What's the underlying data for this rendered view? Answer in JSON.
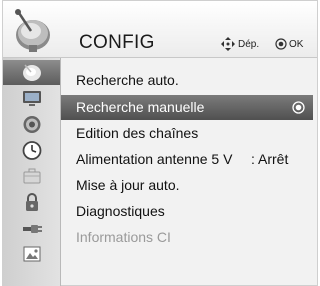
{
  "header": {
    "title": "CONFIG",
    "hints": {
      "nav_icon": "four-way-arrows-icon",
      "nav_label": "Dép.",
      "ok_icon": "ok-circle-icon",
      "ok_label": "OK"
    },
    "logo_icon": "satellite-dish-icon"
  },
  "sidebar": {
    "items": [
      {
        "icon": "satellite-dish-icon",
        "active": true
      },
      {
        "icon": "monitor-icon",
        "active": false
      },
      {
        "icon": "speaker-icon",
        "active": false
      },
      {
        "icon": "clock-icon",
        "active": false
      },
      {
        "icon": "briefcase-icon",
        "active": false
      },
      {
        "icon": "padlock-icon",
        "active": false
      },
      {
        "icon": "input-plug-icon",
        "active": false
      },
      {
        "icon": "media-photo-icon",
        "active": false
      }
    ]
  },
  "menu": {
    "items": [
      {
        "label": "Recherche auto.",
        "value": "",
        "state": "normal"
      },
      {
        "label": "Recherche manuelle",
        "value": "",
        "state": "selected"
      },
      {
        "label": "Edition des chaînes",
        "value": "",
        "state": "normal"
      },
      {
        "label": "Alimentation antenne 5 V",
        "value": ": Arrêt",
        "state": "normal"
      },
      {
        "label": "Mise à jour auto.",
        "value": "",
        "state": "normal"
      },
      {
        "label": "Diagnostiques",
        "value": "",
        "state": "normal"
      },
      {
        "label": "Informations CI",
        "value": "",
        "state": "disabled"
      }
    ]
  },
  "colors": {
    "selected_bar": "#636363",
    "disabled_text": "#9a9a9a",
    "panel_bg": "#f2f2f2"
  }
}
